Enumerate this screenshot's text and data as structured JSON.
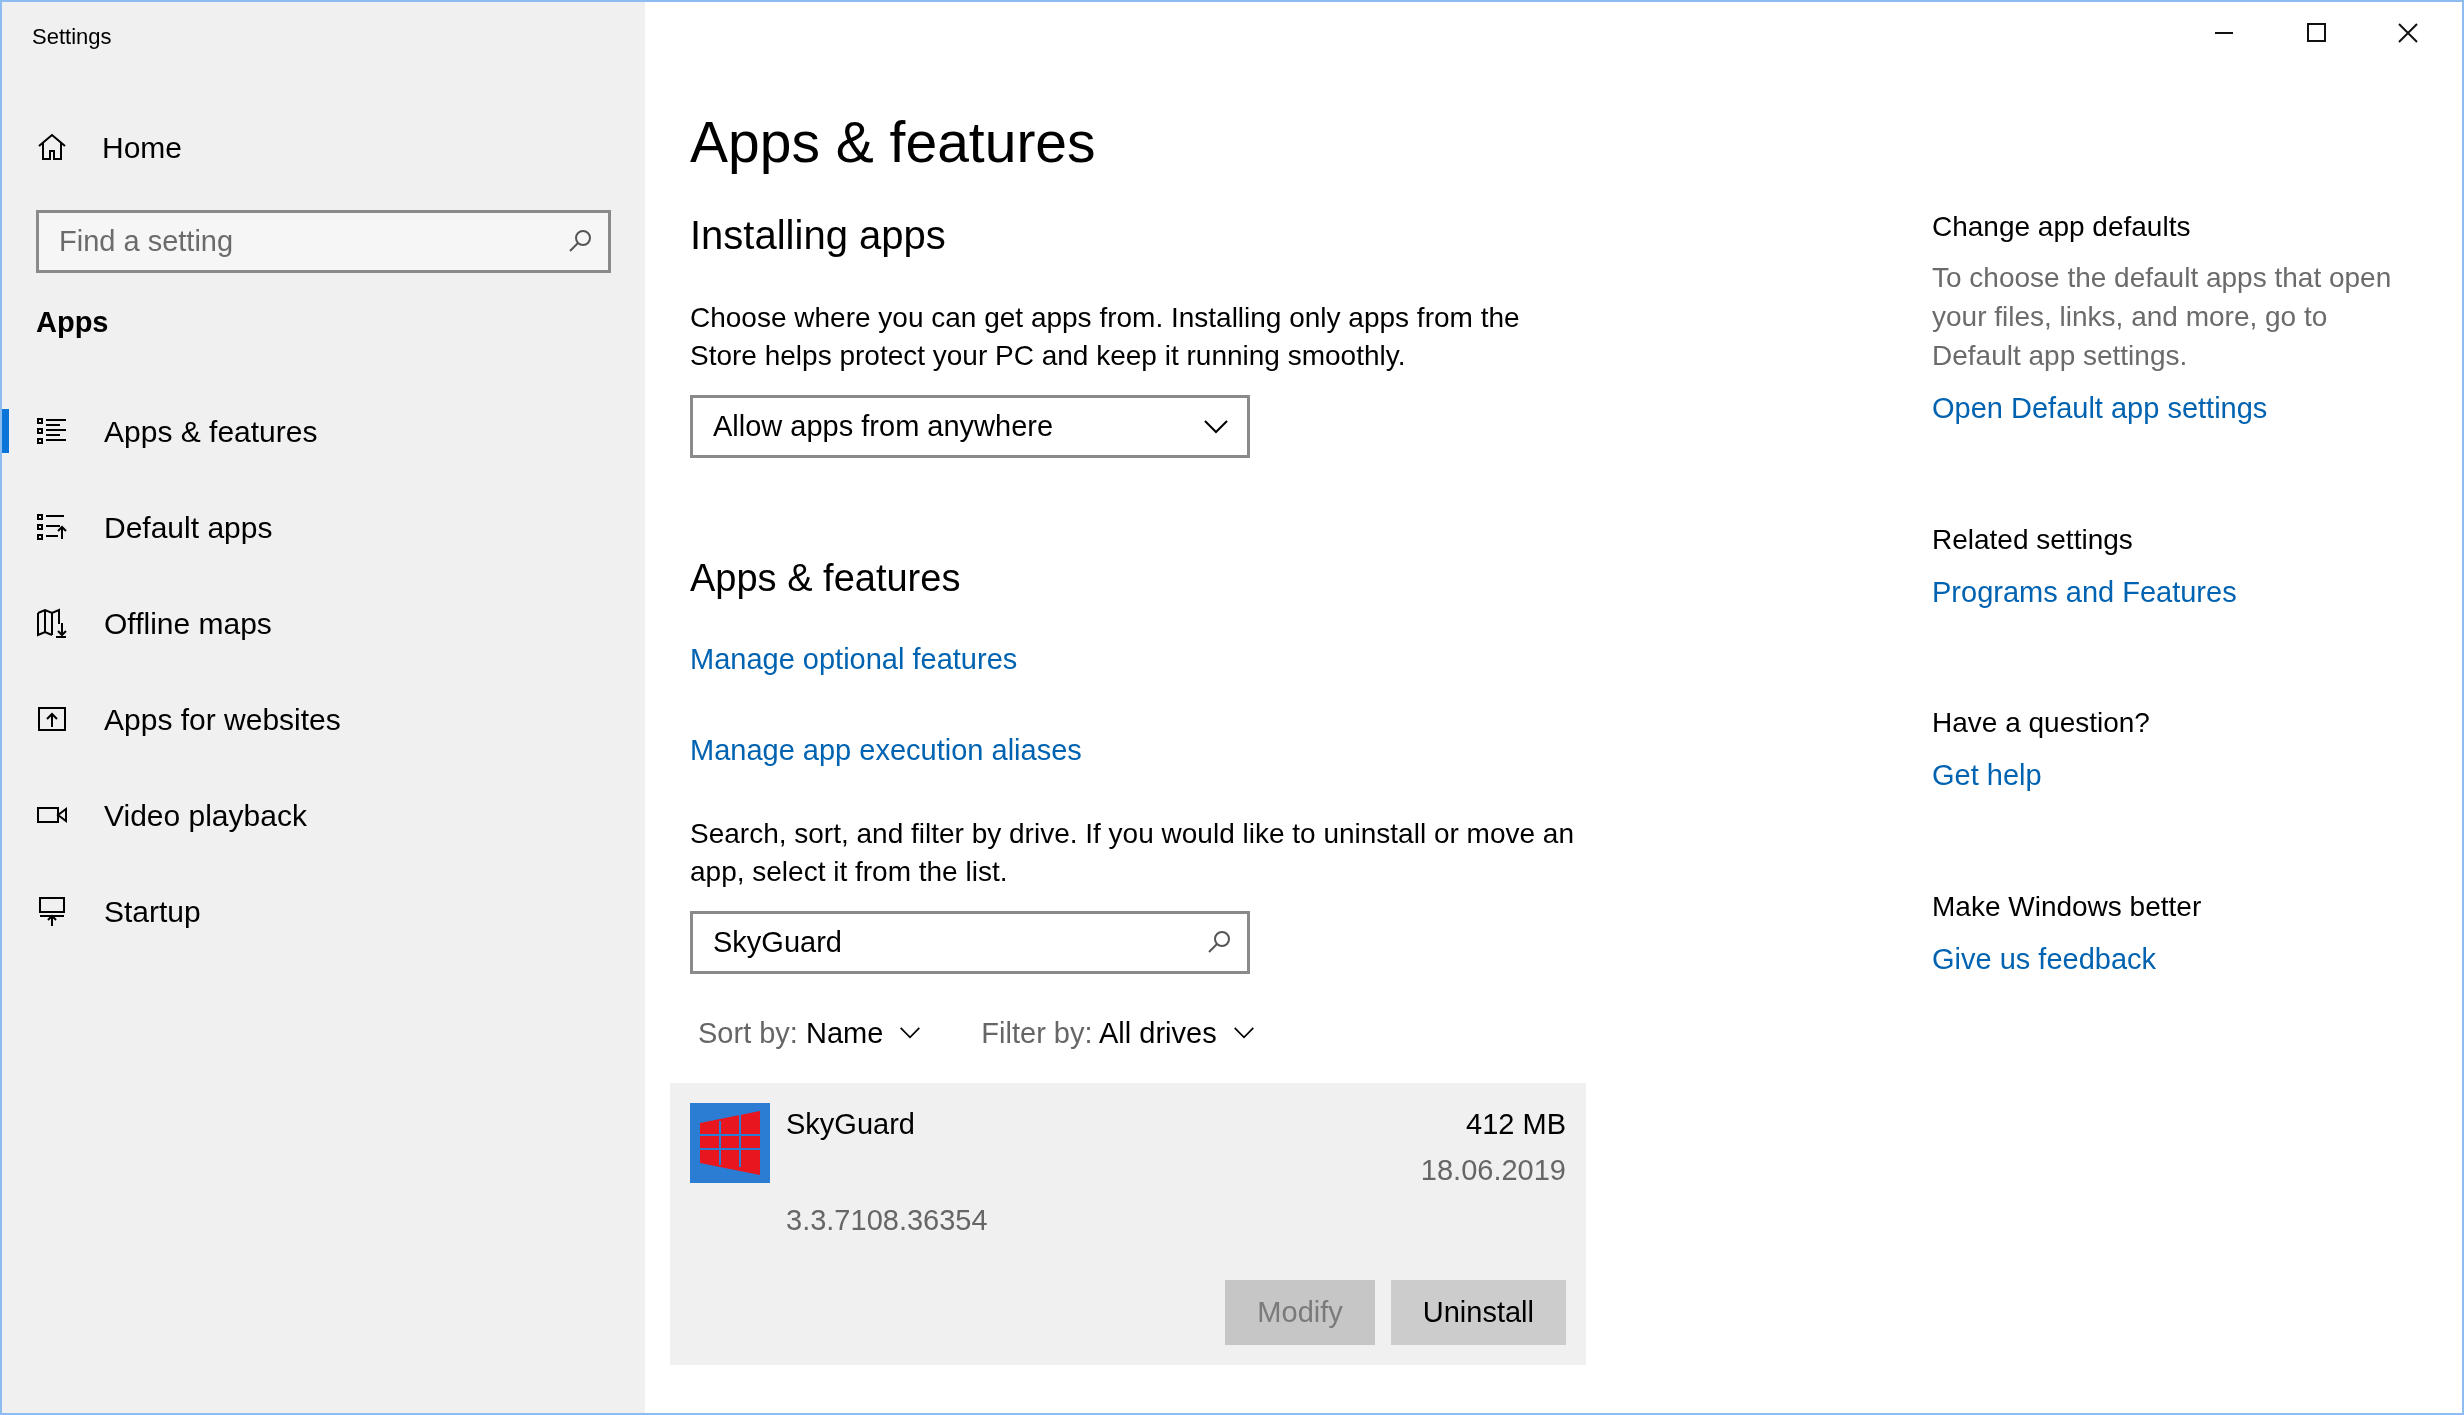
{
  "window": {
    "title": "Settings"
  },
  "sidebar": {
    "home": "Home",
    "search": {
      "placeholder": "Find a setting"
    },
    "section": "Apps",
    "items": [
      {
        "label": "Apps & features",
        "kind": "list",
        "selected": true
      },
      {
        "label": "Default apps",
        "kind": "defaults",
        "selected": false
      },
      {
        "label": "Offline maps",
        "kind": "maps",
        "selected": false
      },
      {
        "label": "Apps for websites",
        "kind": "websites",
        "selected": false
      },
      {
        "label": "Video playback",
        "kind": "video",
        "selected": false
      },
      {
        "label": "Startup",
        "kind": "startup",
        "selected": false
      }
    ]
  },
  "main": {
    "title": "Apps & features",
    "installing": {
      "heading": "Installing apps",
      "description": "Choose where you can get apps from. Installing only apps from the Store helps protect your PC and keep it running smoothly.",
      "dropdown": "Allow apps from anywhere"
    },
    "features": {
      "heading": "Apps & features",
      "links": [
        "Manage optional features",
        "Manage app execution aliases"
      ],
      "description": "Search, sort, and filter by drive. If you would like to uninstall or move an app, select it from the list.",
      "search": {
        "value": "SkyGuard"
      },
      "sort": {
        "label": "Sort by:",
        "value": "Name"
      },
      "filter": {
        "label": "Filter by:",
        "value": "All drives"
      },
      "apps": [
        {
          "name": "SkyGuard",
          "size": "412 MB",
          "date": "18.06.2019",
          "version": "3.3.7108.36354",
          "selected": true,
          "buttons": [
            {
              "label": "Modify",
              "disabled": true
            },
            {
              "label": "Uninstall",
              "disabled": false
            }
          ]
        }
      ]
    }
  },
  "related": [
    {
      "heading": "Change app defaults",
      "text": "To choose the default apps that open your files, links, and more, go to Default app settings.",
      "link": "Open Default app settings"
    },
    {
      "heading": "Related settings",
      "link": "Programs and Features"
    },
    {
      "heading": "Have a question?",
      "link": "Get help"
    },
    {
      "heading": "Make Windows better",
      "link": "Give us feedback"
    }
  ]
}
